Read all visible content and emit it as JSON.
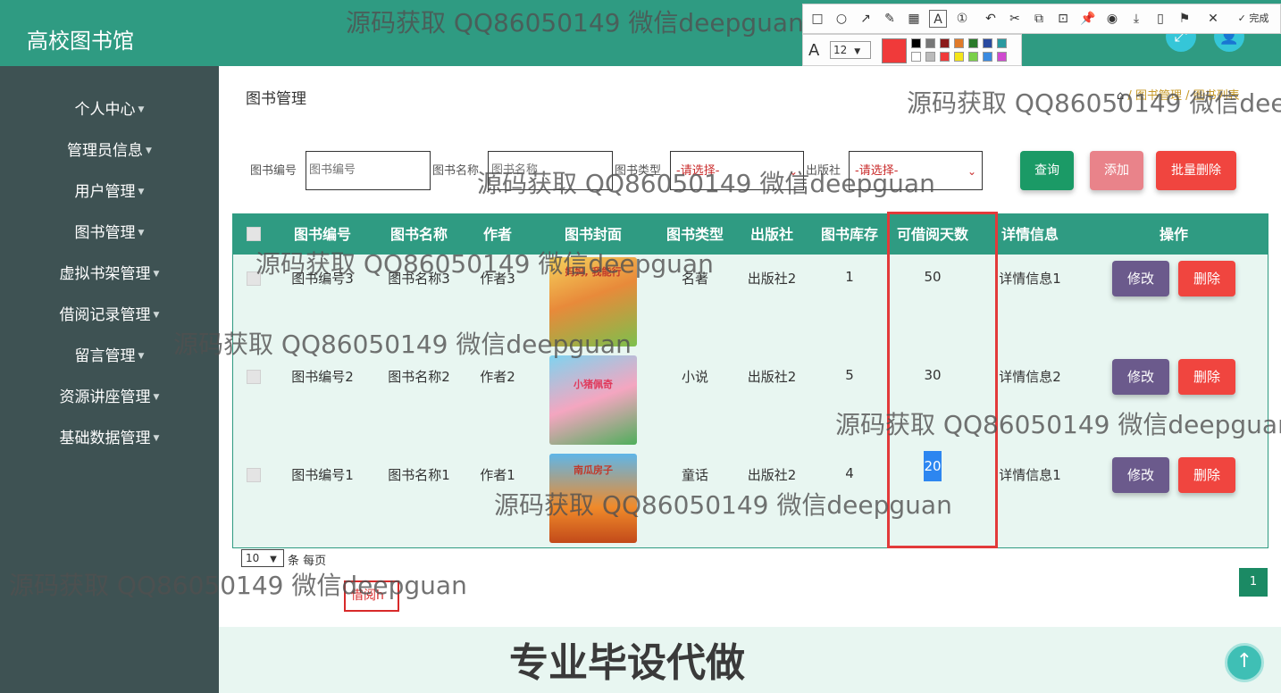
{
  "site_title": "高校图书馆",
  "sidebar": {
    "items": [
      {
        "label": "个人中心"
      },
      {
        "label": "管理员信息"
      },
      {
        "label": "用户管理"
      },
      {
        "label": "图书管理"
      },
      {
        "label": "虚拟书架管理"
      },
      {
        "label": "借阅记录管理"
      },
      {
        "label": "留言管理"
      },
      {
        "label": "资源讲座管理"
      },
      {
        "label": "基础数据管理"
      }
    ]
  },
  "page_title": "图书管理",
  "breadcrumb": {
    "sep": "/",
    "item1": "图书管理",
    "item2": "图书列表"
  },
  "filters": {
    "book_no_label": "图书编号",
    "book_no_placeholder": "图书编号",
    "book_name_label": "图书名称",
    "book_name_placeholder": "图书名称",
    "book_type_label": "图书类型",
    "book_type_value": "-请选择-",
    "publisher_label": "出版社",
    "publisher_value": "-请选择-"
  },
  "buttons": {
    "query": "查询",
    "add": "添加",
    "batch_delete": "批量删除",
    "edit": "修改",
    "delete": "删除"
  },
  "table": {
    "headers": [
      "图书编号",
      "图书名称",
      "作者",
      "图书封面",
      "图书类型",
      "出版社",
      "图书库存",
      "可借阅天数",
      "详情信息",
      "操作"
    ],
    "rows": [
      {
        "no": "图书编号3",
        "name": "图书名称3",
        "author": "作者3",
        "cover": "妈妈, 我能行",
        "type": "名著",
        "publisher": "出版社2",
        "stock": "1",
        "days": "50",
        "detail": "详情信息1"
      },
      {
        "no": "图书编号2",
        "name": "图书名称2",
        "author": "作者2",
        "cover": "小猪佩奇",
        "type": "小说",
        "publisher": "出版社2",
        "stock": "5",
        "days": "30",
        "detail": "详情信息2"
      },
      {
        "no": "图书编号1",
        "name": "图书名称1",
        "author": "作者1",
        "cover": "南瓜房子",
        "type": "童话",
        "publisher": "出版社2",
        "stock": "4",
        "days": "20",
        "detail": "详情信息1"
      }
    ]
  },
  "pager": {
    "page_size": "10",
    "page_size_suffix": "条 每页",
    "current_page": "1"
  },
  "annotation_box_text": "借阅h",
  "footer_text": "专业毕设代做",
  "annotation_toolbar": {
    "font_size": "12",
    "done": "完成",
    "font_icon": "A"
  },
  "watermark": "源码获取 QQ86050149 微信deepguan",
  "colors": {
    "primary": "#2f9b82",
    "sidebar": "#3e5253",
    "query": "#1b9a66",
    "add": "#e9838a",
    "batch_delete": "#f0453f",
    "edit": "#6b5a8c",
    "delete": "#f0453f",
    "highlight": "#e23a3a"
  }
}
